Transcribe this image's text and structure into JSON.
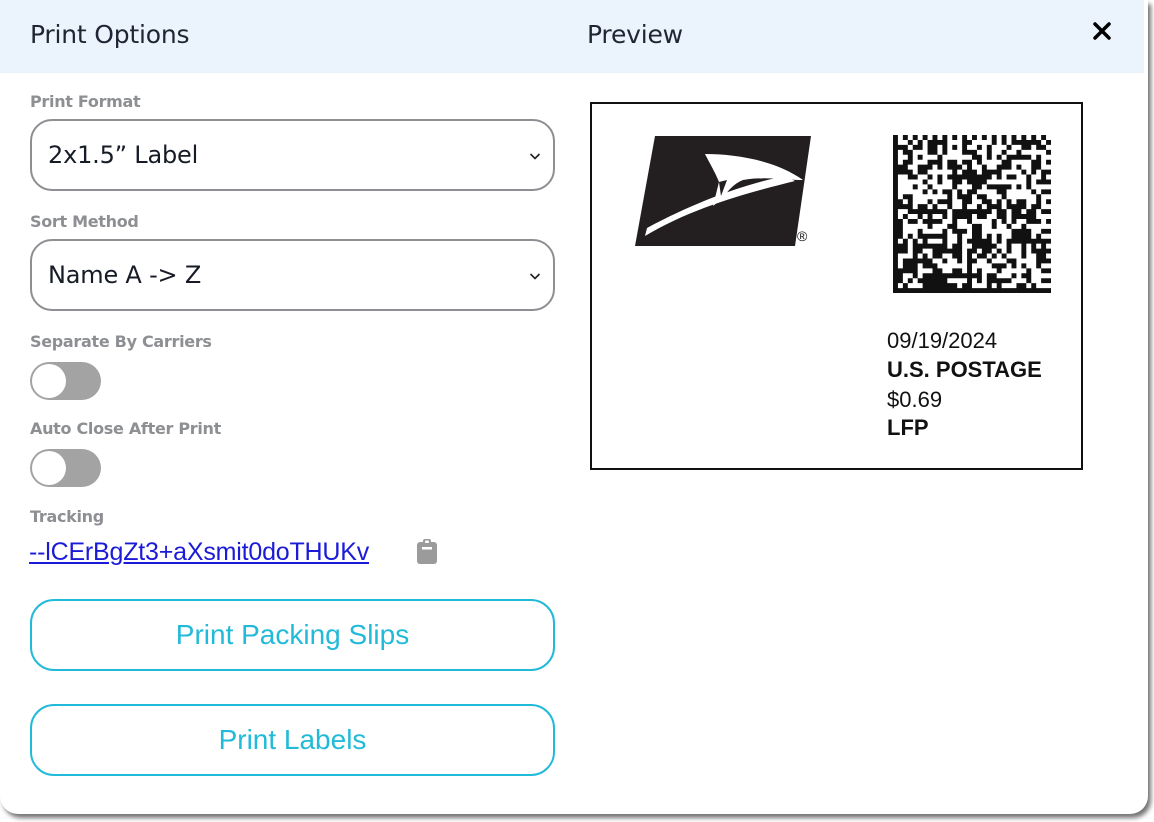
{
  "header": {
    "left_title": "Print Options",
    "right_title": "Preview",
    "close_icon": "close-icon"
  },
  "print_format": {
    "label": "Print Format",
    "selected": "2x1.5” Label"
  },
  "sort_method": {
    "label": "Sort Method",
    "selected": "Name A -> Z"
  },
  "separate_by_carriers": {
    "label": "Separate By Carriers",
    "enabled": false
  },
  "auto_close": {
    "label": "Auto Close After Print",
    "enabled": false
  },
  "tracking": {
    "label": "Tracking",
    "value": "--lCErBgZt3+aXsmit0doTHUKv",
    "copy_icon": "clipboard-icon"
  },
  "buttons": {
    "packing_slips": "Print Packing Slips",
    "labels": "Print Labels"
  },
  "preview": {
    "logo_icon": "usps-eagle-logo",
    "registered_mark": "®",
    "barcode_icon": "datamatrix-barcode",
    "date": "09/19/2024",
    "postage_title": "U.S. POSTAGE",
    "amount": "$0.69",
    "service": "LFP"
  },
  "colors": {
    "header_bg": "#ebf4fd",
    "accent": "#22bad9",
    "link": "#1a1ad8",
    "toggle_off": "#a3a3a3"
  }
}
